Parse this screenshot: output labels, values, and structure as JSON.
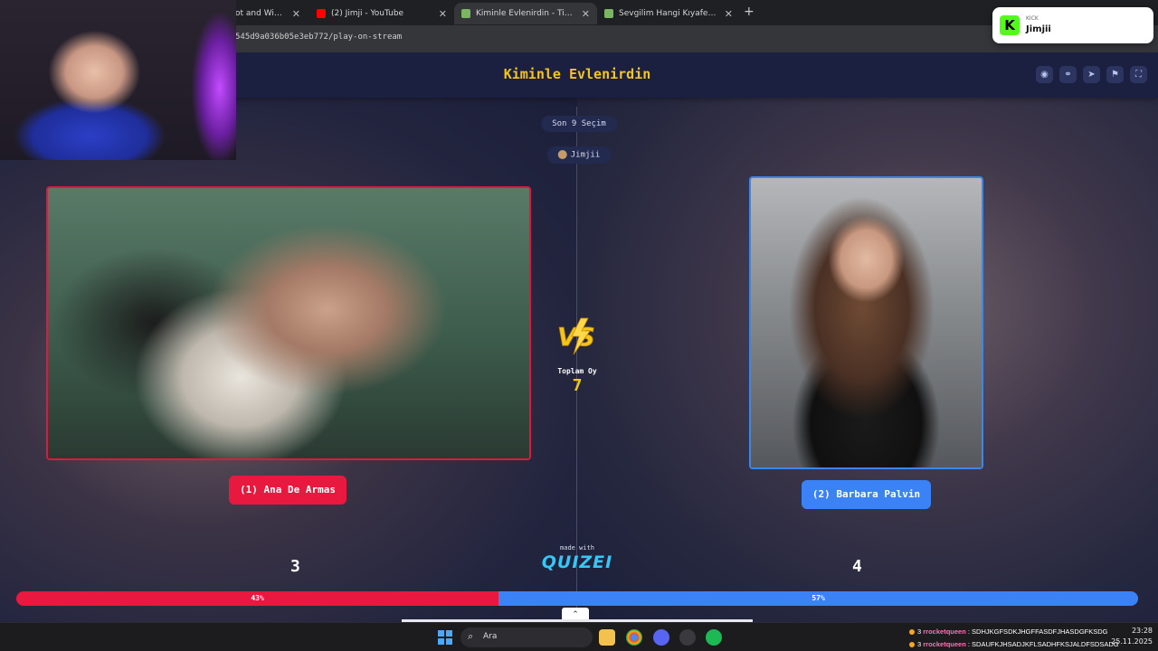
{
  "browser": {
    "tabs": [
      {
        "title": "ot and Widgets",
        "active": false,
        "color": "#3a7bd5"
      },
      {
        "title": "(2) Jimji - YouTube",
        "active": false,
        "color": "#ff0000"
      },
      {
        "title": "Kiminle Evlenirdin - Tier List, Ko",
        "active": true,
        "color": "#7bb661"
      },
      {
        "title": "Sevgilim Hangi Kıyafeti Dışarda",
        "active": false,
        "color": "#7bb661"
      }
    ],
    "url": "545d9a036b05e3eb772/play-on-stream"
  },
  "toast": {
    "platform": "KICK",
    "name": "Jimjii",
    "logo": "K"
  },
  "page": {
    "title": "Kiminle Evlenirdin",
    "round_label": "Son 9 Seçim",
    "host": "Jimjii",
    "left": {
      "name": "(1) Ana De Armas",
      "votes": "3",
      "percent": "43%",
      "share": 0.43
    },
    "right": {
      "name": "(2) Barbara Palvin",
      "votes": "4",
      "percent": "57%",
      "share": 0.57
    },
    "total_label": "Toplam Oy",
    "total_value": "7",
    "made_with": "made with",
    "brand": "QUIZEI",
    "colors": {
      "left": "#e8183f",
      "right": "#3b82f6",
      "accent": "#f5c518",
      "background": "#1a1e38"
    }
  },
  "taskbar": {
    "search_placeholder": "Ara",
    "chat": [
      {
        "badge": "3",
        "user": "rrocketqueen",
        "message": ": SDHJKGFSDKJHGFFASDFJHASDGFKSDG"
      },
      {
        "badge": "3",
        "user": "rrocketqueen",
        "message": ": SDAUFKJHSADJKFLSADHFKSJALDFSDSADG"
      }
    ],
    "time": "23:28",
    "date": "25.11.2025"
  }
}
